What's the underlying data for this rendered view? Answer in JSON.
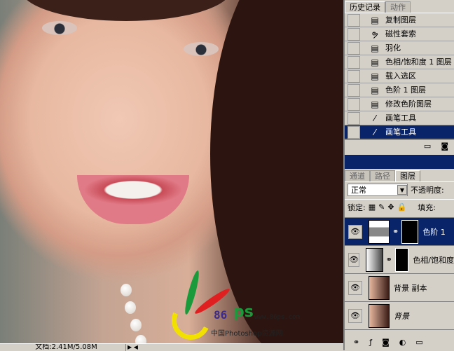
{
  "status": {
    "doc": "文档:2.41M/5.08M"
  },
  "watermark": {
    "num": "86",
    "ps": "ps",
    "url": "www.86ps.com",
    "cn": "中国Photoshop资源网"
  },
  "history": {
    "tabs": [
      "历史记录",
      "动作"
    ],
    "items": [
      {
        "label": "复制图层",
        "icon": "action-icon"
      },
      {
        "label": "磁性套索",
        "icon": "magnetic-lasso-icon"
      },
      {
        "label": "羽化",
        "icon": "action-icon"
      },
      {
        "label": "色相/饱和度 1 图层",
        "icon": "action-icon"
      },
      {
        "label": "载入选区",
        "icon": "action-icon"
      },
      {
        "label": "色阶 1 图层",
        "icon": "action-icon"
      },
      {
        "label": "修改色阶图层",
        "icon": "action-icon"
      },
      {
        "label": "画笔工具",
        "icon": "brush-icon"
      },
      {
        "label": "画笔工具",
        "icon": "brush-icon",
        "selected": true
      }
    ]
  },
  "layers": {
    "tabs": [
      "通道",
      "路径",
      "图层"
    ],
    "blend": "正常",
    "opacity_label": "不透明度:",
    "lock_label": "锁定:",
    "fill_label": "填充:",
    "items": [
      {
        "name": "色阶 1",
        "selected": true
      },
      {
        "name": "色相/饱和度"
      },
      {
        "name": "背景 副本"
      },
      {
        "name": "背景"
      }
    ]
  }
}
